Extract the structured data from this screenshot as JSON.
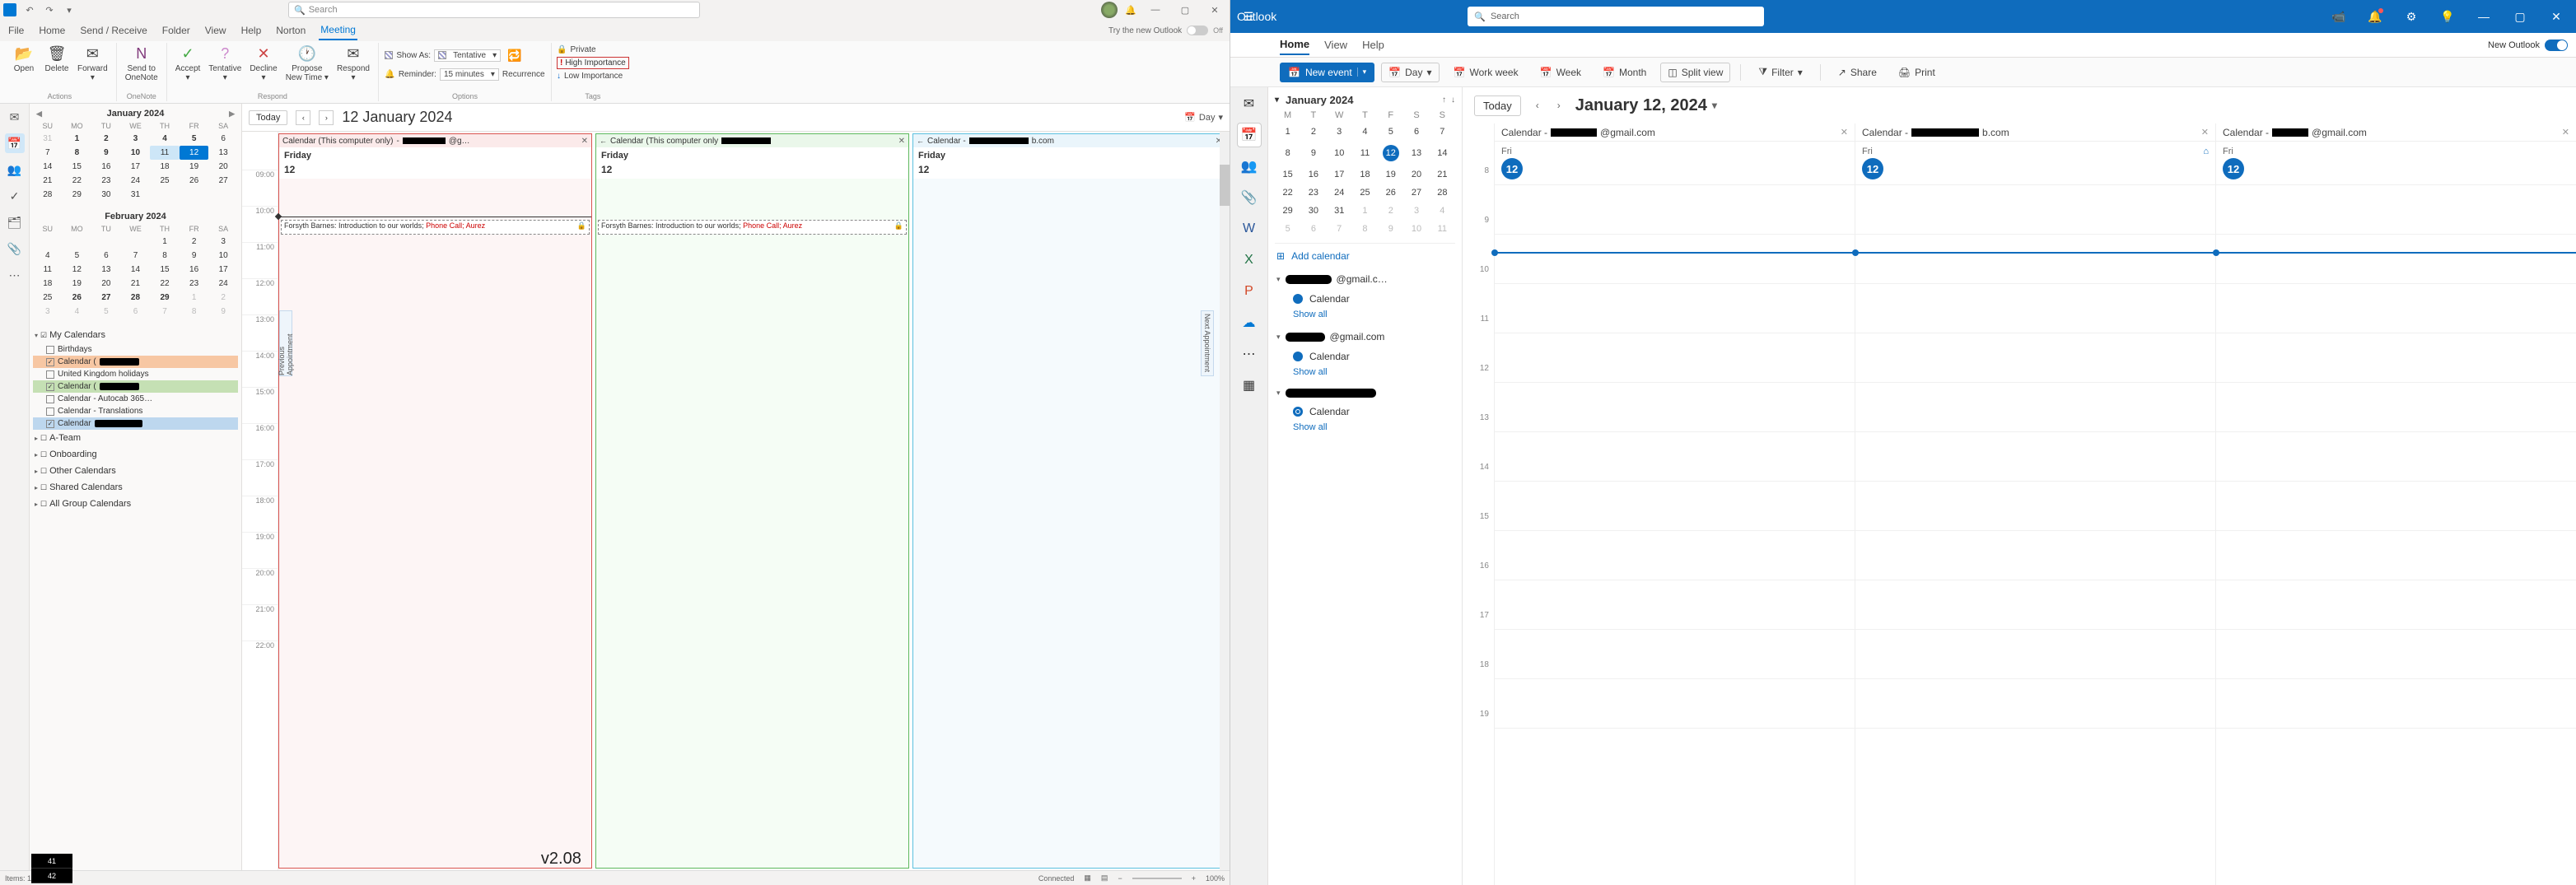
{
  "left": {
    "titlebar": {
      "search_placeholder": "Search"
    },
    "tabs": {
      "file": "File",
      "home": "Home",
      "sendrecv": "Send / Receive",
      "folder": "Folder",
      "view": "View",
      "help": "Help",
      "norton": "Norton",
      "meeting": "Meeting",
      "try_new": "Try the new Outlook",
      "off": "Off"
    },
    "ribbon": {
      "open": "Open",
      "delete": "Delete",
      "forward": "Forward",
      "onenote": "Send to\nOneNote",
      "accept": "Accept",
      "tentative": "Tentative",
      "decline": "Decline",
      "propose": "Propose\nNew Time",
      "respond": "Respond",
      "showas": "Show As:",
      "showas_val": "Tentative",
      "reminder": "Reminder:",
      "reminder_val": "15 minutes",
      "recurrence": "Recurrence",
      "private": "Private",
      "high": "High Importance",
      "low": "Low Importance",
      "grp_actions": "Actions",
      "grp_onenote": "OneNote",
      "grp_respond": "Respond",
      "grp_options": "Options",
      "grp_tags": "Tags"
    },
    "side": {
      "month1": "January 2024",
      "month2": "February 2024",
      "dow": [
        "SU",
        "MO",
        "TU",
        "WE",
        "TH",
        "FR",
        "SA"
      ],
      "my_cal": "My Calendars",
      "items": {
        "birthdays": "Birthdays",
        "cal1": "Calendar (",
        "uk": "United Kingdom holidays",
        "cal2": "Calendar (",
        "autocab": "Calendar - Autocab 365…",
        "trans": "Calendar - Translations",
        "cal3": "Calendar"
      },
      "groups": {
        "ateam": "A-Team",
        "onboarding": "Onboarding",
        "other": "Other Calendars",
        "shared": "Shared Calendars",
        "allgroup": "All Group Calendars"
      }
    },
    "main": {
      "today": "Today",
      "title": "12 January 2024",
      "view": "Day",
      "col1": "Calendar (This computer only)",
      "col1_suffix": "@g…",
      "col2": "Calendar (This computer only",
      "col3": "Calendar - ",
      "col3_suffix": "b.com",
      "friday": "Friday",
      "date": "12",
      "evt1_a": "Forsyth Barnes: Introduction to our worlds; ",
      "evt1_b": "Phone Call; Aurez",
      "evt2_a": "Forsyth Barnes: Introduction to our worlds; ",
      "evt2_b": "Phone Call; Aurez",
      "hours": [
        "09:00",
        "10:00",
        "11:00",
        "12:00",
        "13:00",
        "14:00",
        "15:00",
        "16:00",
        "17:00",
        "18:00",
        "19:00",
        "20:00",
        "21:00",
        "22:00"
      ],
      "prev_appt": "Previous Appointment",
      "next_appt": "Next Appointment"
    },
    "status": {
      "items": "Items: 1",
      "connected": "Connected",
      "zoom": "100%"
    },
    "watermark": "v2.08",
    "wk": [
      "41",
      "42"
    ]
  },
  "right": {
    "brand": "Outlook",
    "search_placeholder": "Search",
    "tabs": {
      "home": "Home",
      "view": "View",
      "help": "Help",
      "new_outlook": "New Outlook"
    },
    "toolbar": {
      "new_event": "New event",
      "day": "Day",
      "work_week": "Work week",
      "week": "Week",
      "month": "Month",
      "split": "Split view",
      "filter": "Filter",
      "share": "Share",
      "print": "Print"
    },
    "side": {
      "month": "January 2024",
      "dow": [
        "M",
        "T",
        "W",
        "T",
        "F",
        "S",
        "S"
      ],
      "add_cal": "Add calendar",
      "acct1_suffix": "@gmail.c…",
      "acct2_suffix": "@gmail.com",
      "calendar": "Calendar",
      "show_all": "Show all"
    },
    "main": {
      "today": "Today",
      "title": "January 12, 2024",
      "col_prefix": "Calendar - ",
      "col1_suffix": "@gmail.com",
      "col2_suffix": "b.com",
      "col3_suffix": "@gmail.com",
      "fri": "Fri",
      "date": "12",
      "hours": [
        "8",
        "9",
        "10",
        "11",
        "12",
        "13",
        "14",
        "15",
        "16",
        "17",
        "18",
        "19"
      ]
    }
  }
}
